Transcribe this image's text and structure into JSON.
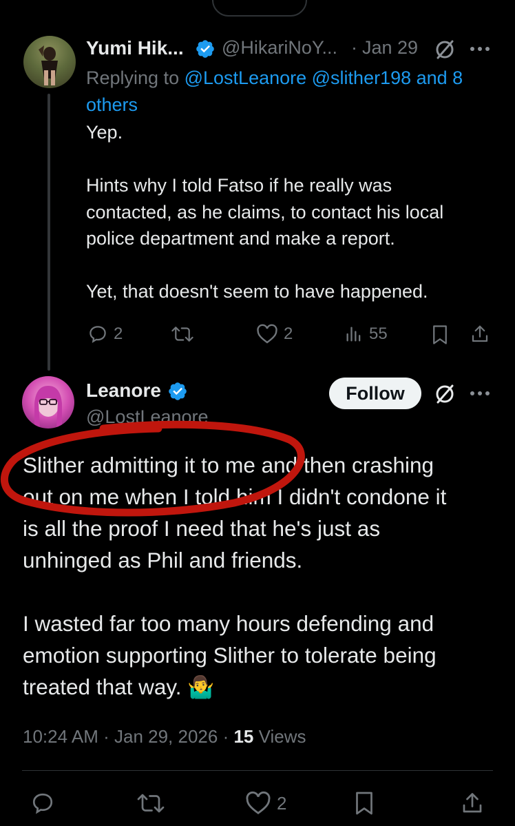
{
  "tweet1": {
    "name": "Yumi Hik...",
    "handle": "@HikariNoY...",
    "sep": "·",
    "date": "Jan 29",
    "replying_prefix": "Replying to",
    "replying_mentions": "@LostLeanore @slither198 and 8 others",
    "lines": [
      "Yep.",
      "",
      "Hints why I told Fatso if he really was",
      "contacted, as he claims, to contact his local",
      "police department and make a report.",
      "",
      "Yet, that doesn't seem to have happened."
    ],
    "replies": "2",
    "likes": "2",
    "views": "55"
  },
  "tweet2": {
    "name": "Leanore",
    "handle": "@LostLeanore",
    "follow_label": "Follow",
    "lines": [
      "Slither admitting it to me and then crashing",
      "out on me when I told him I didn't condone it",
      "is all the proof I need that he's just as",
      "unhinged as Phil and friends.",
      "",
      "I wasted far too many hours defending and",
      "emotion supporting Slither to tolerate being",
      "treated that way."
    ],
    "emoji": "🤷‍♂️",
    "time": "10:24 AM",
    "date": "Jan 29, 2026",
    "views_count": "15",
    "views_label": "Views",
    "likes": "2"
  },
  "colors": {
    "accent": "#1d9bf0",
    "muted": "#71767b",
    "background": "#000000",
    "annotation": "#c0160d"
  },
  "icons": [
    "verified-icon",
    "grok-icon",
    "more-icon",
    "reply-icon",
    "retweet-icon",
    "like-icon",
    "views-icon",
    "bookmark-icon",
    "share-icon"
  ]
}
